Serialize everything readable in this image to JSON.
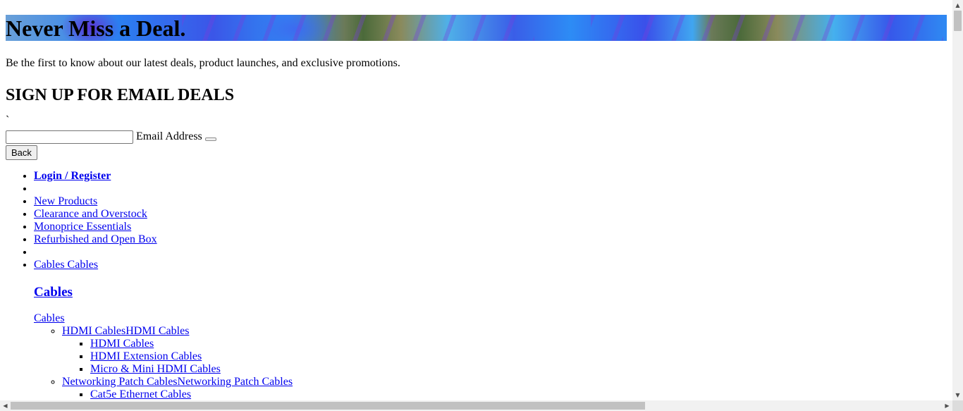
{
  "banner": {
    "title": "Never Miss a Deal."
  },
  "intro": "Be the first to know about our latest deals, product launches, and exclusive promotions.",
  "signup": {
    "heading": "SIGN UP FOR EMAIL DEALS",
    "tick": "`",
    "email_label": "Email Address",
    "email_value": "",
    "back_label": "Back"
  },
  "nav": {
    "login": "Login / Register",
    "links": [
      "New Products",
      "Clearance and Overstock",
      "Monoprice Essentials",
      "Refurbished and Open Box"
    ],
    "cables_link": "Cables Cables",
    "cables_heading": "Cables",
    "cables_sub": "Cables",
    "groups": [
      {
        "label": "HDMI CablesHDMI Cables",
        "items": [
          "HDMI Cables",
          "HDMI Extension Cables",
          "Micro & Mini HDMI Cables"
        ]
      },
      {
        "label": "Networking Patch CablesNetworking Patch Cables",
        "items": [
          "Cat5e Ethernet Cables"
        ]
      }
    ]
  },
  "scrollbars": {
    "up": "▲",
    "down": "▼",
    "left": "◀",
    "right": "▶"
  }
}
